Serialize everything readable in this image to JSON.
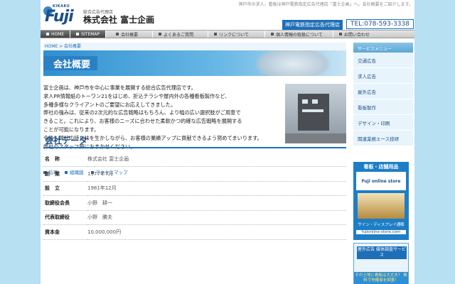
{
  "header": {
    "logo_sub": "KIKAKU",
    "logo_word": "Fuji",
    "company_small": "総合広告代理店",
    "company_name": "株式会社 富士企画",
    "tagline": "神戸市の求人、看板は神戸電鉄指定広告代理店「富士企画」へ。会社概要をご紹介します。",
    "badge": "神戸電鉄指定広告代理店",
    "tel": "TEL:078-593-3338"
  },
  "nav": {
    "items": [
      "HOME",
      "SITEMAP",
      "会社概要",
      "よくあるご質問",
      "リンクについて",
      "個人情報の取扱について",
      "お問い合わせ"
    ]
  },
  "breadcrumb": "HOME > 会社概要",
  "hero": {
    "title": "会社概要"
  },
  "intro": {
    "lines": [
      "富士企画は、神戸市を中心に事業を展開する総合広告代理店です。",
      "求人PR情報紙のトーワン21をはじめ、折込チラシや屋内外の各種看板製作など、",
      "多種多様なクライアントのご要望にお応えしてきました。",
      "弊社の強みは、従来の2次元的な広告戦略はもちろん、より幅の広い選択肢がご用意で",
      "きること。これにより、お客様のニーズに合わせた柔軟かつ的確な広告戦略を展開する",
      "ことが可能になります。",
      "今後も弊社の持ち味を生かしながら、お客様の業績アップに貢献できるよう努めてまいります。",
      "弊社のスタッフ陣におまかせください。"
    ],
    "links": [
      "沿革",
      "組織図",
      "アクセスマップ"
    ]
  },
  "company_data": {
    "title": "会社データ",
    "rows": [
      {
        "key": "名　称",
        "value": "株式会社 富士企画"
      },
      {
        "key": "創　業",
        "value": "1977年7月"
      },
      {
        "key": "設　立",
        "value": "1981年12月"
      },
      {
        "key": "取締役会長",
        "value": "小野　耕一"
      },
      {
        "key": "代表取締役",
        "value": "小野　勝夫"
      },
      {
        "key": "資本金",
        "value": "10,000,000円"
      }
    ]
  },
  "sidebar": {
    "heading": "サービスメニュー",
    "items": [
      "交通広告",
      "求人広告",
      "屋外広告",
      "看板製作",
      "デザイン・印刷",
      "関連業務エース技研"
    ]
  },
  "banner1": {
    "title": "看板・店舗用品",
    "logo_text": "Fuji online store",
    "caption": "サイン・ディスプレイ通販",
    "url": "fujionline-store.com"
  },
  "banner2": {
    "title": "屋外広告 媒体調査サービス",
    "bottom": "その土地に看板は大丈夫？ 無料で地権者を調査！"
  },
  "colors": {
    "accent": "#1d6fb8",
    "background": "#b7e0f2"
  }
}
